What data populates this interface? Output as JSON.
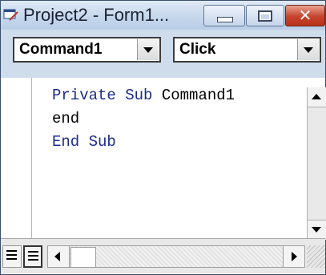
{
  "window": {
    "title": "Project2 - Form1...",
    "icon": "vb-form-icon",
    "controls": {
      "minimize": "minimize-icon",
      "maximize": "maximize-icon",
      "close": "✕"
    }
  },
  "combos": {
    "object": {
      "value": "Command1"
    },
    "procedure": {
      "value": "Click"
    }
  },
  "code": {
    "lines": [
      {
        "kw1": "Private",
        "sp1": " ",
        "kw2": "Sub",
        "rest": " Command1"
      },
      {
        "text": "end"
      },
      {
        "kw1": "End",
        "sp1": " ",
        "kw2": "Sub"
      }
    ]
  },
  "colors": {
    "keyword": "#1c2c8c",
    "title_bar": "#c4d6ec",
    "close_button": "#c7432c"
  }
}
